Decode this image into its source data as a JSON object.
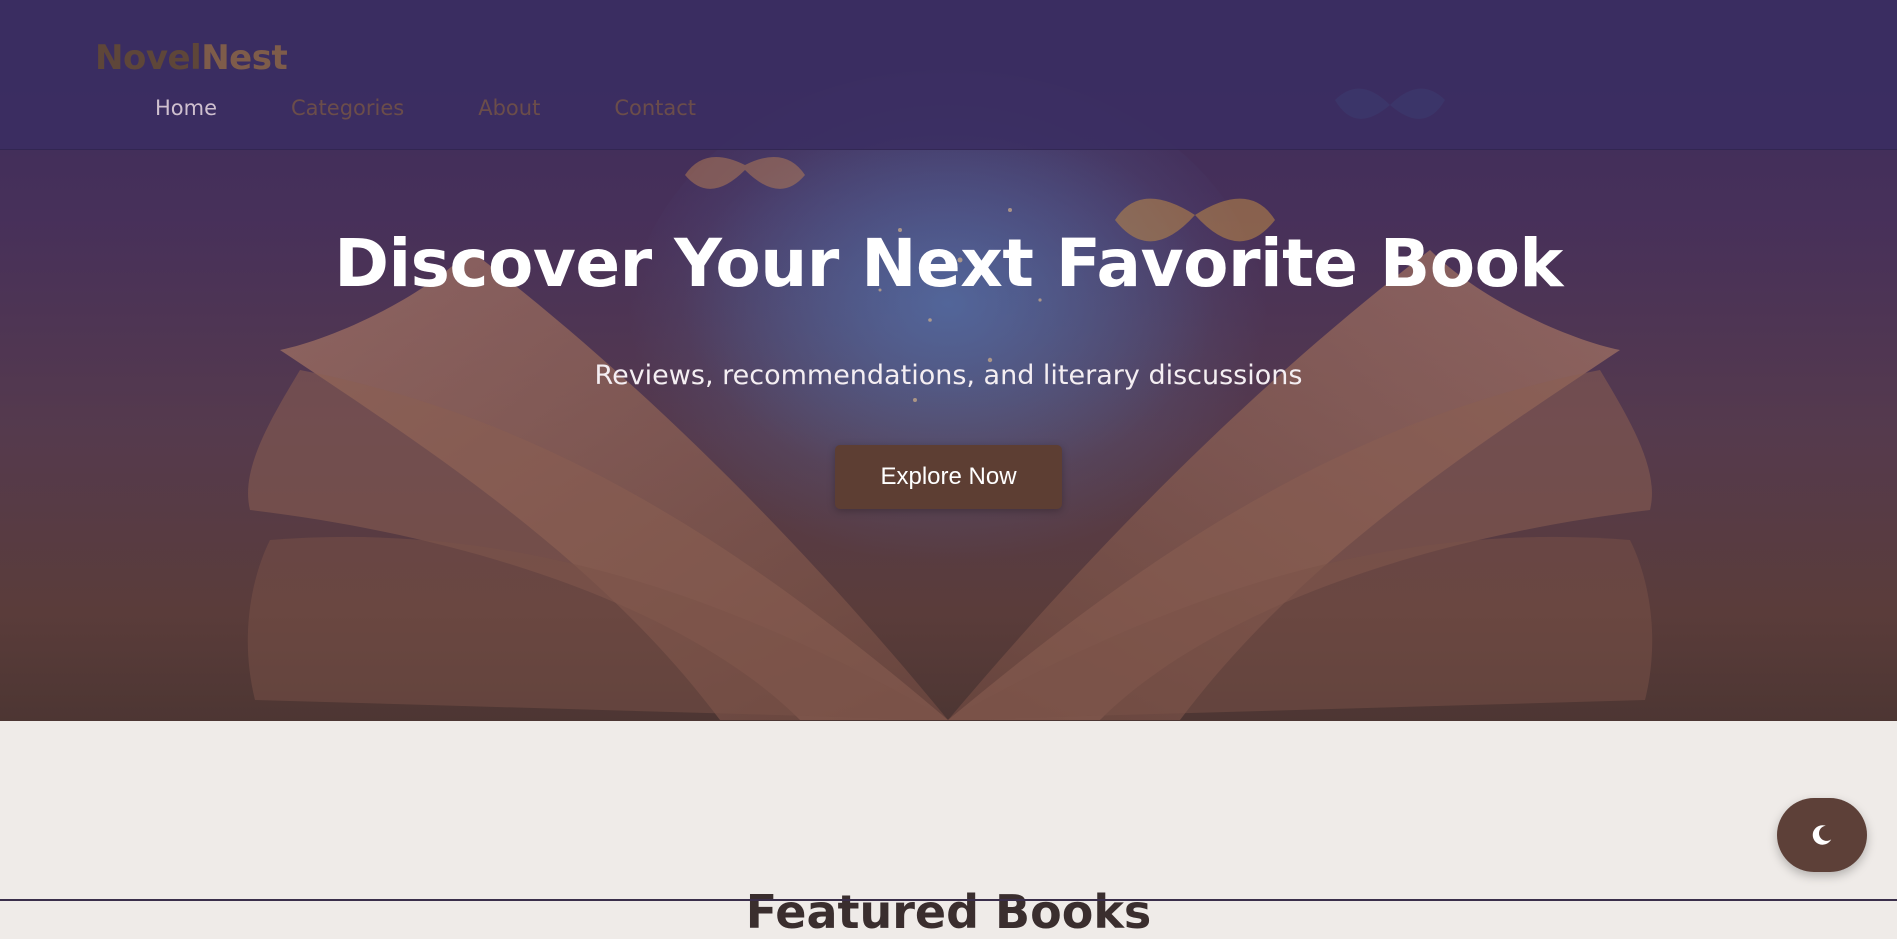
{
  "header": {
    "logo_part1": "Novel",
    "logo_part2": "Nest",
    "nav": [
      {
        "label": "Home",
        "active": true
      },
      {
        "label": "Categories",
        "active": false
      },
      {
        "label": "About",
        "active": false
      },
      {
        "label": "Contact",
        "active": false
      }
    ]
  },
  "hero": {
    "title": "Discover Your Next Favorite Book",
    "subtitle": "Reviews, recommendations, and literary discussions",
    "cta_label": "Explore Now",
    "background_art": "open-book-with-butterflies"
  },
  "featured": {
    "title": "Featured Books"
  },
  "theme_toggle": {
    "icon": "moon-icon"
  },
  "colors": {
    "nav_bg": "#3a2d62",
    "accent_brown": "#5d3e33",
    "page_bg": "#efebe8",
    "hero_text": "#ffffff"
  }
}
